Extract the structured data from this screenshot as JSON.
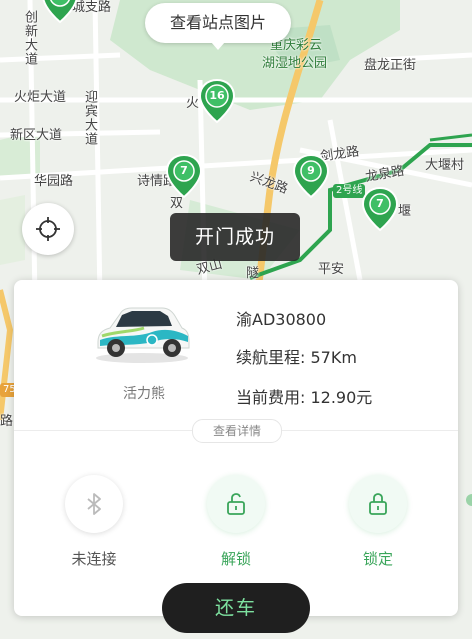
{
  "map": {
    "labels": {
      "chengzhi_road": "城支路",
      "chuangxin_avenue": "创新大道",
      "huoju_avenue": "火炬大道",
      "yingbin_avenue": "迎宾大道",
      "xinqu_avenue": "新区大道",
      "huayuan_road": "华园路",
      "shiqing_road": "诗情路",
      "shuang_fragment": "双",
      "huo_fragment": "火",
      "xinglong_road": "兴龙路",
      "jianlong_road": "剑龙路",
      "longquan_road": "龙泉路",
      "panlong_zhengji": "盘龙正街",
      "dayan_village": "大堰村",
      "qing_fragment": "堰",
      "park_line1": "重庆彩云",
      "park_line2": "湖湿地公园",
      "line2": "2号线",
      "ping_an": "平安",
      "shuangshan_fragment": "双山",
      "sui_fragment": "隧",
      "left_badge": "75",
      "left_fragment": "路"
    },
    "pins": [
      {
        "id": "top-left",
        "count": ""
      },
      {
        "id": "center-top",
        "count": "16"
      },
      {
        "id": "center-left",
        "count": "7"
      },
      {
        "id": "center-right",
        "count": "9"
      },
      {
        "id": "right",
        "count": "7"
      }
    ],
    "colors": {
      "pin": "#2ea44f",
      "road_major": "#f5c86a",
      "park": "#cfe8cf",
      "metro": "#2ea44f"
    }
  },
  "photo_tip": "查看站点图片",
  "toast": "开门成功",
  "car": {
    "plate": "渝AD30800",
    "range": "续航里程: 57Km",
    "cost": "当前费用: 12.90元",
    "model_name": "活力熊",
    "detail_button": "查看详情"
  },
  "actions": {
    "bluetooth": {
      "label": "未连接",
      "icon": "bluetooth-icon"
    },
    "unlock": {
      "label": "解锁",
      "icon": "unlock-icon"
    },
    "lock": {
      "label": "锁定",
      "icon": "lock-icon"
    }
  },
  "return_button": "还车",
  "accent_color": "#3aa55a"
}
